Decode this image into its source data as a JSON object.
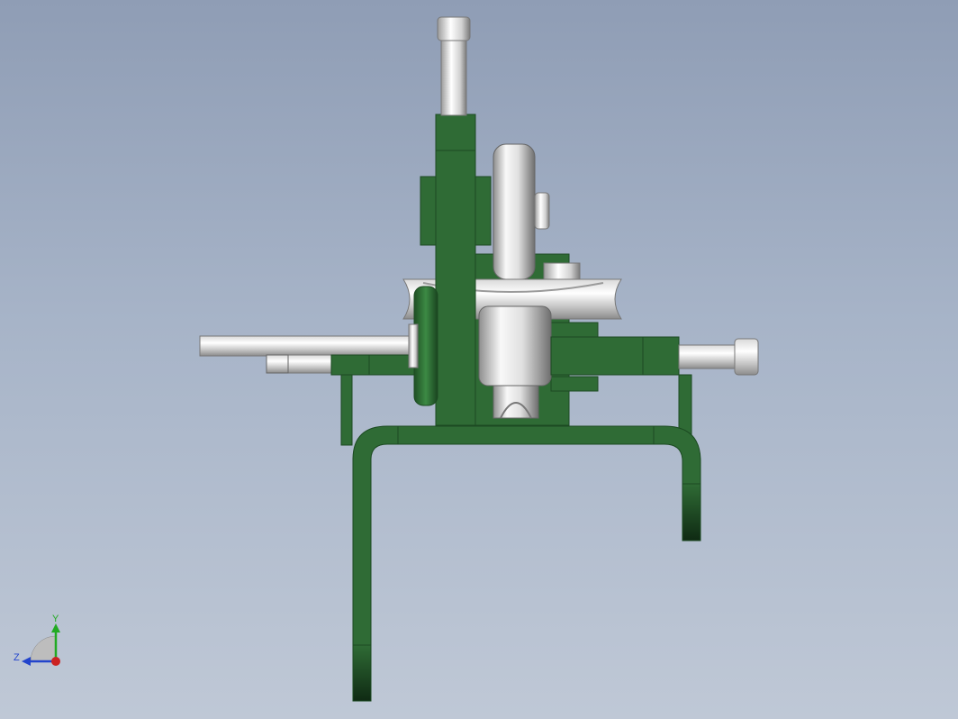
{
  "viewport": {
    "background_top": "#8f9db5",
    "background_bottom": "#bfc8d6"
  },
  "model": {
    "frame_color": "#2f6b35",
    "frame_edge": "#1c4a22",
    "metal_light": "#f2f2f2",
    "metal_dark": "#8a8a8a"
  },
  "triad": {
    "y_label": "Y",
    "z_label": "Z",
    "y_color": "#22aa22",
    "z_color": "#2244cc",
    "x_color": "#cc2222"
  }
}
